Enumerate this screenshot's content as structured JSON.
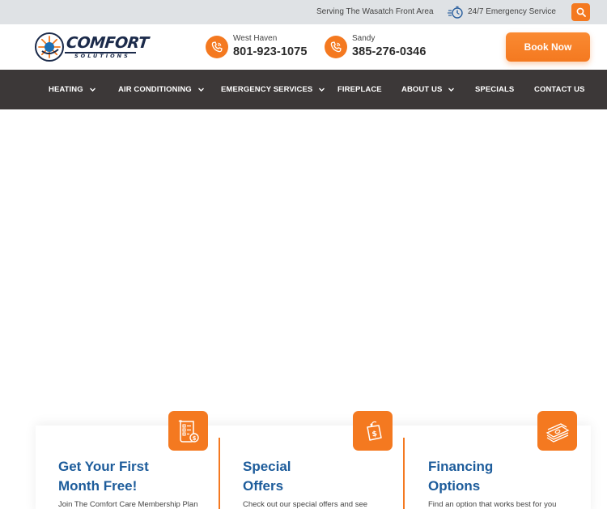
{
  "topbar": {
    "serving": "Serving The Wasatch Front Area",
    "emergency": "24/7 Emergency Service",
    "search_icon": "search-icon",
    "emergency_icon": "stopwatch-icon"
  },
  "header": {
    "logo_main": "COMFORT",
    "logo_sub": "SOLUTIONS",
    "phones": [
      {
        "location": "West Haven",
        "number": "801-923-1075"
      },
      {
        "location": "Sandy",
        "number": "385-276-0346"
      }
    ],
    "book_label": "Book Now"
  },
  "nav": {
    "items": [
      {
        "label": "HEATING",
        "has_dropdown": true
      },
      {
        "label": "AIR CONDITIONING",
        "has_dropdown": true
      },
      {
        "label": "EMERGENCY SERVICES",
        "has_dropdown": true
      },
      {
        "label": "FIREPLACE",
        "has_dropdown": false
      },
      {
        "label": "ABOUT US",
        "has_dropdown": true
      },
      {
        "label": "SPECIALS",
        "has_dropdown": false
      },
      {
        "label": "CONTACT US",
        "has_dropdown": false
      }
    ]
  },
  "cards": [
    {
      "title_line1": "Get Your First",
      "title_line2": "Month Free!",
      "text": "Join The Comfort Care Membership Plan",
      "icon": "membership-document-icon"
    },
    {
      "title_line1": "Special",
      "title_line2": "Offers",
      "text": "Check out our special offers and see",
      "icon": "price-tag-icon"
    },
    {
      "title_line1": "Financing",
      "title_line2": "Options",
      "text": "Find an option that works best for you",
      "icon": "cash-stack-icon"
    }
  ],
  "colors": {
    "accent": "#f47920",
    "nav_bg": "#3c3838",
    "topbar_bg": "#dfe2e5",
    "title_blue": "#1d5c9b",
    "logo_navy": "#1b2a4a"
  }
}
